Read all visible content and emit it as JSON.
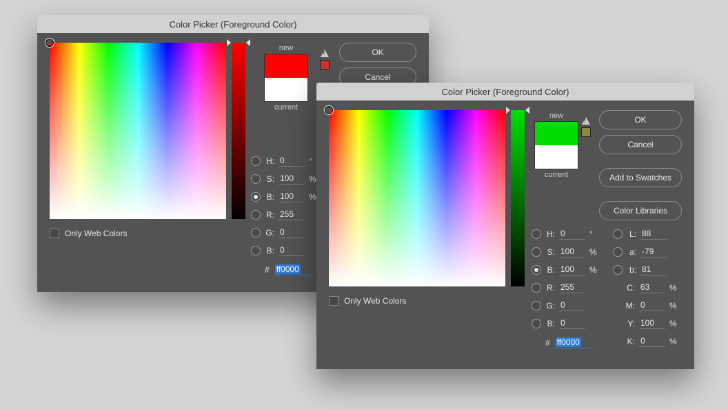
{
  "dialog1": {
    "title": "Color Picker (Foreground Color)",
    "newLabel": "new",
    "currentLabel": "current",
    "newColor": "#ff0000",
    "currentColor": "#ffffff",
    "gamutSwatch": "#c33",
    "buttons": {
      "ok": "OK",
      "cancel": "Cancel"
    },
    "webColorsLabel": "Only Web Colors",
    "hsb": {
      "h": {
        "label": "H:",
        "value": "0",
        "unit": "°"
      },
      "s": {
        "label": "S:",
        "value": "100",
        "unit": "%"
      },
      "b": {
        "label": "B:",
        "value": "100",
        "unit": "%"
      }
    },
    "rgb": {
      "r": {
        "label": "R:",
        "value": "255"
      },
      "g": {
        "label": "G:",
        "value": "0"
      },
      "b": {
        "label": "B:",
        "value": "0"
      }
    },
    "hex": {
      "label": "#",
      "value": "ff0000"
    }
  },
  "dialog2": {
    "title": "Color Picker (Foreground Color)",
    "newLabel": "new",
    "currentLabel": "current",
    "newColor": "#00dd00",
    "currentColor": "#ffffff",
    "gamutSwatch": "#8a8a3c",
    "buttons": {
      "ok": "OK",
      "cancel": "Cancel",
      "add": "Add to Swatches",
      "lib": "Color Libraries"
    },
    "webColorsLabel": "Only Web Colors",
    "hsb": {
      "h": {
        "label": "H:",
        "value": "0",
        "unit": "°"
      },
      "s": {
        "label": "S:",
        "value": "100",
        "unit": "%"
      },
      "b": {
        "label": "B:",
        "value": "100",
        "unit": "%"
      }
    },
    "rgb": {
      "r": {
        "label": "R:",
        "value": "255"
      },
      "g": {
        "label": "G:",
        "value": "0"
      },
      "b": {
        "label": "B:",
        "value": "0"
      }
    },
    "lab": {
      "l": {
        "label": "L:",
        "value": "88"
      },
      "a": {
        "label": "a:",
        "value": "-79"
      },
      "b": {
        "label": "b:",
        "value": "81"
      }
    },
    "cmyk": {
      "c": {
        "label": "C:",
        "value": "63",
        "unit": "%"
      },
      "m": {
        "label": "M:",
        "value": "0",
        "unit": "%"
      },
      "y": {
        "label": "Y:",
        "value": "100",
        "unit": "%"
      },
      "k": {
        "label": "K:",
        "value": "0",
        "unit": "%"
      }
    },
    "hex": {
      "label": "#",
      "value": "ff0000"
    }
  }
}
